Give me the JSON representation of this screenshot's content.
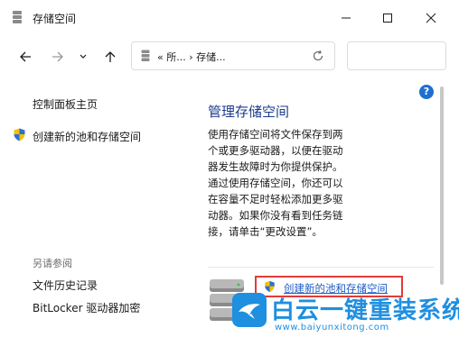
{
  "window": {
    "title": "存储空间"
  },
  "address": {
    "crumbs_prefix": "«",
    "crumb_1": "所...",
    "crumb_2": "存储..."
  },
  "sidebar": {
    "home": "控制面板主页",
    "create_pool": "创建新的池和存储空间",
    "see_also_heading": "另请参阅",
    "file_history": "文件历史记录",
    "bitlocker": "BitLocker 驱动器加密"
  },
  "main": {
    "title": "管理存储空间",
    "description": "使用存储空间将文件保存到两个或更多驱动器，以便在驱动器发生故障时为你提供保护。通过使用存储空间，你还可以在容量不足时轻松添加更多驱动器。如果你没有看到任务链接，请单击“更改设置”。",
    "create_link": "创建新的池和存储空间"
  },
  "watermark": {
    "text": "白云一键重装系统",
    "url": "www.baiyunxitong.com"
  },
  "colors": {
    "link": "#1f5bc7",
    "title_blue": "#1b3c8c",
    "highlight": "#e23b3b"
  }
}
